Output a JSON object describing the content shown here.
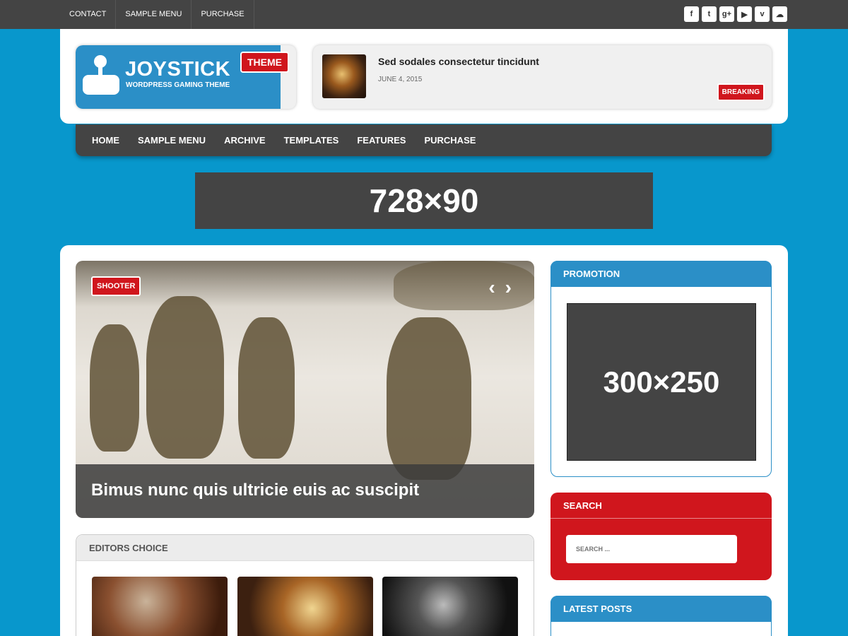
{
  "top_menu": [
    "CONTACT",
    "SAMPLE MENU",
    "PURCHASE"
  ],
  "social_icons": [
    {
      "name": "facebook-icon",
      "glyph": "f"
    },
    {
      "name": "twitter-icon",
      "glyph": "t"
    },
    {
      "name": "google-plus-icon",
      "glyph": "g+"
    },
    {
      "name": "youtube-icon",
      "glyph": "▶"
    },
    {
      "name": "vimeo-icon",
      "glyph": "v"
    },
    {
      "name": "soundcloud-icon",
      "glyph": "☁"
    }
  ],
  "logo": {
    "title": "JOYSTICK",
    "subtitle": "WORDPRESS GAMING THEME",
    "badge": "THEME"
  },
  "breaking": {
    "title": "Sed sodales consectetur tincidunt",
    "date": "JUNE 4, 2015",
    "badge": "BREAKING"
  },
  "main_menu": [
    "HOME",
    "SAMPLE MENU",
    "ARCHIVE",
    "TEMPLATES",
    "FEATURES",
    "PURCHASE"
  ],
  "ad_banner": "728×90",
  "slider": {
    "category": "SHOOTER",
    "prev": "‹",
    "next": "›",
    "caption": "Bimus nunc quis ultricie euis ac suscipit"
  },
  "editors_choice": {
    "title": "EDITORS CHOICE"
  },
  "sidebar": {
    "promotion": {
      "title": "PROMOTION",
      "ad": "300×250"
    },
    "search": {
      "title": "SEARCH",
      "placeholder": "SEARCH ..."
    },
    "latest": {
      "title": "LATEST POSTS"
    }
  },
  "colors": {
    "background": "#0897cc",
    "accent_blue": "#2b8fc7",
    "accent_red": "#d0161d",
    "dark": "#444444"
  }
}
